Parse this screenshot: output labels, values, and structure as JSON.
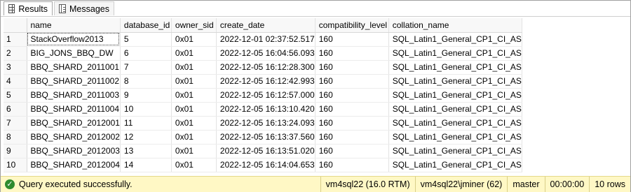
{
  "tabs": [
    {
      "label": "Results",
      "icon": "grid-icon"
    },
    {
      "label": "Messages",
      "icon": "messages-icon"
    }
  ],
  "grid": {
    "columns": [
      "name",
      "database_id",
      "owner_sid",
      "create_date",
      "compatibility_level",
      "collation_name"
    ],
    "rows": [
      {
        "n": "1",
        "cells": [
          "StackOverflow2013",
          "5",
          "0x01",
          "2022-12-01 02:37:52.517",
          "160",
          "SQL_Latin1_General_CP1_CI_AS"
        ]
      },
      {
        "n": "2",
        "cells": [
          "BIG_JONS_BBQ_DW",
          "6",
          "0x01",
          "2022-12-05 16:04:56.093",
          "160",
          "SQL_Latin1_General_CP1_CI_AS"
        ]
      },
      {
        "n": "3",
        "cells": [
          "BBQ_SHARD_2011001",
          "7",
          "0x01",
          "2022-12-05 16:12:28.300",
          "160",
          "SQL_Latin1_General_CP1_CI_AS"
        ]
      },
      {
        "n": "4",
        "cells": [
          "BBQ_SHARD_2011002",
          "8",
          "0x01",
          "2022-12-05 16:12:42.993",
          "160",
          "SQL_Latin1_General_CP1_CI_AS"
        ]
      },
      {
        "n": "5",
        "cells": [
          "BBQ_SHARD_2011003",
          "9",
          "0x01",
          "2022-12-05 16:12:57.000",
          "160",
          "SQL_Latin1_General_CP1_CI_AS"
        ]
      },
      {
        "n": "6",
        "cells": [
          "BBQ_SHARD_2011004",
          "10",
          "0x01",
          "2022-12-05 16:13:10.420",
          "160",
          "SQL_Latin1_General_CP1_CI_AS"
        ]
      },
      {
        "n": "7",
        "cells": [
          "BBQ_SHARD_2012001",
          "11",
          "0x01",
          "2022-12-05 16:13:24.093",
          "160",
          "SQL_Latin1_General_CP1_CI_AS"
        ]
      },
      {
        "n": "8",
        "cells": [
          "BBQ_SHARD_2012002",
          "12",
          "0x01",
          "2022-12-05 16:13:37.560",
          "160",
          "SQL_Latin1_General_CP1_CI_AS"
        ]
      },
      {
        "n": "9",
        "cells": [
          "BBQ_SHARD_2012003",
          "13",
          "0x01",
          "2022-12-05 16:13:51.020",
          "160",
          "SQL_Latin1_General_CP1_CI_AS"
        ]
      },
      {
        "n": "10",
        "cells": [
          "BBQ_SHARD_2012004",
          "14",
          "0x01",
          "2022-12-05 16:14:04.653",
          "160",
          "SQL_Latin1_General_CP1_CI_AS"
        ]
      }
    ]
  },
  "status": {
    "message": "Query executed successfully.",
    "icon": "success-check-icon",
    "server": "vm4sql22 (16.0 RTM)",
    "user": "vm4sql22\\jminer (62)",
    "database": "master",
    "elapsed": "00:00:00",
    "rows": "10 rows",
    "bar_color": "#fff8c5"
  }
}
